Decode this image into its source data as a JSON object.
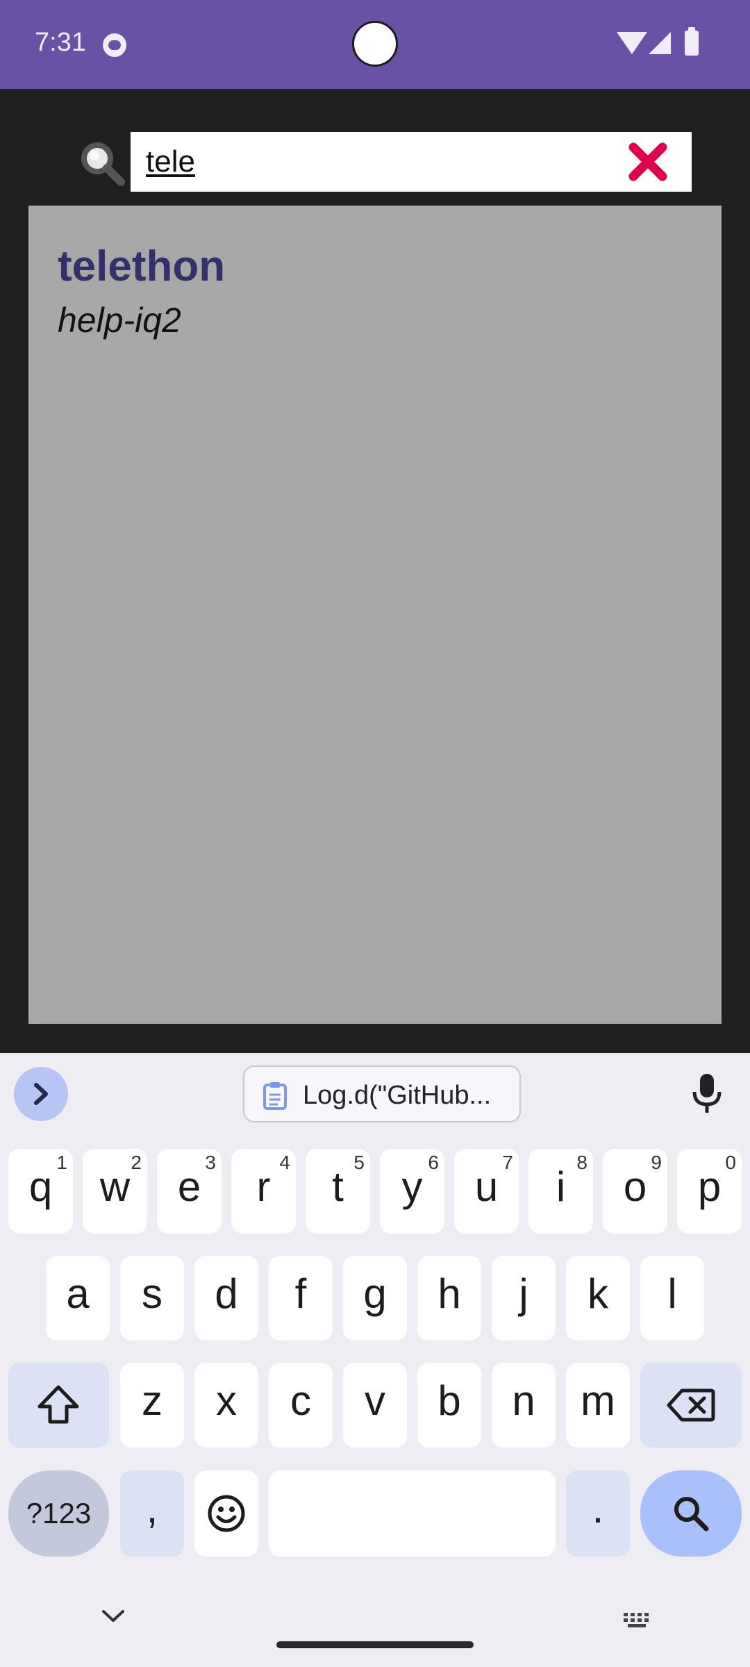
{
  "status_bar": {
    "time": "7:31"
  },
  "search": {
    "query": "tele"
  },
  "results": [
    {
      "title": "telethon",
      "subtitle": "help-iq2"
    }
  ],
  "keyboard": {
    "clipboard_text": "Log.d(\"GitHub...",
    "row1": [
      {
        "key": "q",
        "hint": "1"
      },
      {
        "key": "w",
        "hint": "2"
      },
      {
        "key": "e",
        "hint": "3"
      },
      {
        "key": "r",
        "hint": "4"
      },
      {
        "key": "t",
        "hint": "5"
      },
      {
        "key": "y",
        "hint": "6"
      },
      {
        "key": "u",
        "hint": "7"
      },
      {
        "key": "i",
        "hint": "8"
      },
      {
        "key": "o",
        "hint": "9"
      },
      {
        "key": "p",
        "hint": "0"
      }
    ],
    "row2": [
      "a",
      "s",
      "d",
      "f",
      "g",
      "h",
      "j",
      "k",
      "l"
    ],
    "row3": [
      "z",
      "x",
      "c",
      "v",
      "b",
      "n",
      "m"
    ],
    "symbols_label": "?123",
    "comma": ",",
    "period": "."
  },
  "colors": {
    "status_bar": "#6951a6",
    "background": "#202020",
    "results_panel": "#a8a8a8",
    "result_title": "#34306a",
    "clear_icon": "#e0004d",
    "search_key": "#a9c0fb"
  }
}
